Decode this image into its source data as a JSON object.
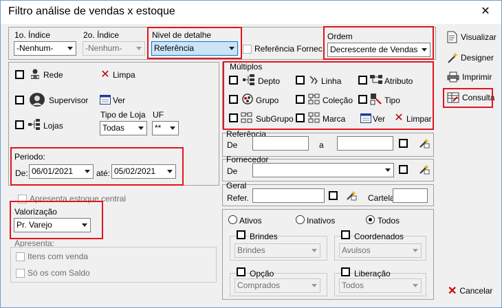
{
  "window": {
    "title": "Filtro análise de vendas x estoque",
    "close": "✕"
  },
  "top": {
    "indice1_label": "1o. Índice",
    "indice1_value": "-Nenhum-",
    "indice2_label": "2o. Índice",
    "indice2_value": "-Nenhum-",
    "nivel_label": "Nivel de detalhe",
    "nivel_value": "Referência",
    "ref_fornec_label": "Referência Fornec.",
    "ordem_label": "Ordem",
    "ordem_value": "Decrescente de Vendas"
  },
  "left": {
    "rede": "Rede",
    "limpa": "Limpa",
    "supervisor": "Supervisor",
    "ver": "Ver",
    "lojas": "Lojas",
    "tipo_loja_label": "Tipo de Loja",
    "tipo_loja_value": "Todas",
    "uf_label": "UF",
    "uf_value": "**",
    "periodo_label": "Periodo:",
    "de_label": "De:",
    "de_value": "06/01/2021",
    "ate_label": "até:",
    "ate_value": "05/02/2021",
    "apresenta_estoque": "Apresenta estoque central",
    "valorizacao_label": "Valorização",
    "valorizacao_value": "Pr. Varejo",
    "apresenta_label": "Apresenta:",
    "itens_venda": "Itens com venda",
    "so_saldo": "Só os com Saldo"
  },
  "multiplos": {
    "label": "Múltiplos",
    "depto": "Depto",
    "linha": "Linha",
    "atributo": "Atributo",
    "grupo": "Grupo",
    "colecao": "Coleção",
    "tipo": "Tipo",
    "subgrupo": "SubGrupo",
    "marca": "Marca",
    "ver": "Ver",
    "limpar": "Limpar"
  },
  "referencia": {
    "label": "Referência",
    "de": "De",
    "a": "a"
  },
  "fornecedor": {
    "label": "Fornecedor",
    "de": "De"
  },
  "geral": {
    "label": "Geral",
    "refer": "Refer.",
    "cartela": "Cartela"
  },
  "status": {
    "ativos": "Ativos",
    "inativos": "Inativos",
    "todos": "Todos"
  },
  "filters": {
    "brindes_label": "Brindes",
    "brindes_value": "Brindes",
    "coordenados_label": "Coordenados",
    "coordenados_value": "Avulsos",
    "opcao_label": "Opção",
    "opcao_value": "Comprados",
    "liberacao_label": "Liberação",
    "liberacao_value": "Todos"
  },
  "side": {
    "visualizar": "Visualizar",
    "designer": "Designer",
    "imprimir": "Imprimir",
    "consulta": "Consulta",
    "cancelar": "Cancelar"
  },
  "colors": {
    "highlight": "#e0141e",
    "selection": "#cce4f7"
  }
}
